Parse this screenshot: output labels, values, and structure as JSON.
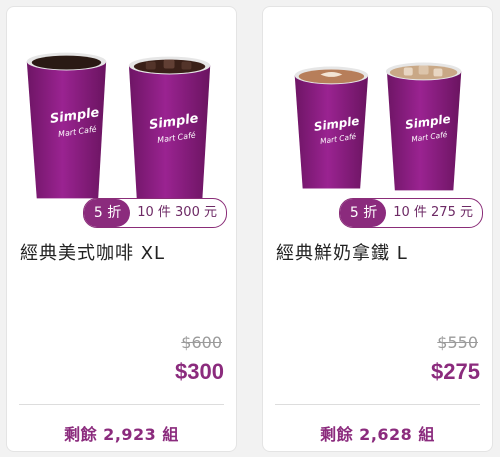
{
  "products": [
    {
      "name": "經典美式咖啡 XL",
      "discount": "5 折",
      "bulk_offer": "10 件 300 元",
      "original_price": "$600",
      "price": "$300",
      "remaining": "剩餘 2,923 組",
      "cup_brand": "Simple",
      "cup_sub": "Mart Café",
      "drinks": [
        "hot-black-coffee",
        "iced-black-coffee"
      ]
    },
    {
      "name": "經典鮮奶拿鐵 L",
      "discount": "5 折",
      "bulk_offer": "10 件 275 元",
      "original_price": "$550",
      "price": "$275",
      "remaining": "剩餘 2,628 組",
      "cup_brand": "Simple",
      "cup_sub": "Mart Café",
      "drinks": [
        "hot-latte",
        "iced-latte"
      ]
    }
  ],
  "colors": {
    "accent": "#8b2b7d",
    "cup": "#8b1d7e",
    "muted": "#9b9b9b"
  }
}
